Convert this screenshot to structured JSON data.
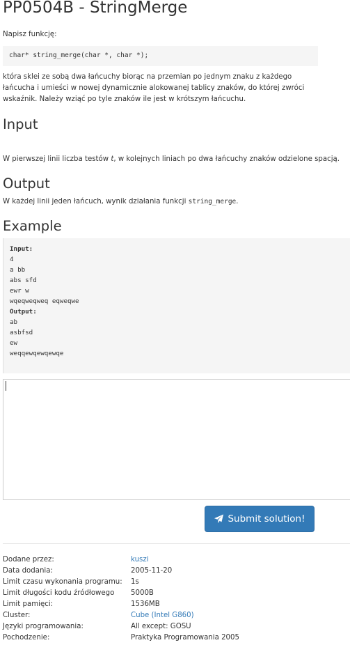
{
  "title": "PP0504B - StringMerge",
  "intro": "Napisz funkcję:",
  "signature": "char* string_merge(char *, char *);",
  "description_lines": [
    "która sklei ze sobą dwa łańcuchy biorąc na przemian po jednym znaku z każdego",
    "łańcucha i umieści w nowej dynamicznie alokowanej tablicy znaków, do której zwróci",
    "wskaźnik. Należy wziąć po tyle znaków ile jest w krótszym łańcuchu."
  ],
  "input_heading": "Input",
  "input_text_before": "W pierwszej linii liczba testów ",
  "input_text_var": "t",
  "input_text_after": ", w kolejnych liniach po dwa łańcuchy znaków odzielone spacją.",
  "output_heading": "Output",
  "output_text_before": "W każdej linii jeden łańcuch, wynik działania funkcji ",
  "output_text_code": "string_merge",
  "output_text_after": ".",
  "example_heading": "Example",
  "example": {
    "input_label": "Input:",
    "input_lines": [
      "4",
      "a bb",
      "abs sfd",
      "ewr w",
      "wqeqweqweq eqweqwe"
    ],
    "output_label": "Output:",
    "output_lines": [
      "ab",
      "asbfsd",
      "ew",
      "weqqewqewqewqe"
    ]
  },
  "submit_label": "Submit solution!",
  "submit_icon": "paper-plane-icon",
  "colors": {
    "accent": "#337ab7",
    "text": "#333333",
    "code_bg": "#f5f5f5"
  },
  "meta": [
    {
      "label": "Dodane przez:",
      "value": "kuszi",
      "link": true
    },
    {
      "label": "Data dodania:",
      "value": "2005-11-20",
      "link": false
    },
    {
      "label": "Limit czasu wykonania programu:",
      "value": "1s",
      "link": false
    },
    {
      "label": "Limit długości kodu źródłowego",
      "value": "5000B",
      "link": false
    },
    {
      "label": "Limit pamięci:",
      "value": "1536MB",
      "link": false
    },
    {
      "label": "Cluster:",
      "value": "Cube (Intel G860)",
      "link": true
    },
    {
      "label": "Języki programowania:",
      "value": "All except: GOSU",
      "link": false
    },
    {
      "label": "Pochodzenie:",
      "value": "Praktyka Programowania 2005",
      "link": false
    }
  ]
}
